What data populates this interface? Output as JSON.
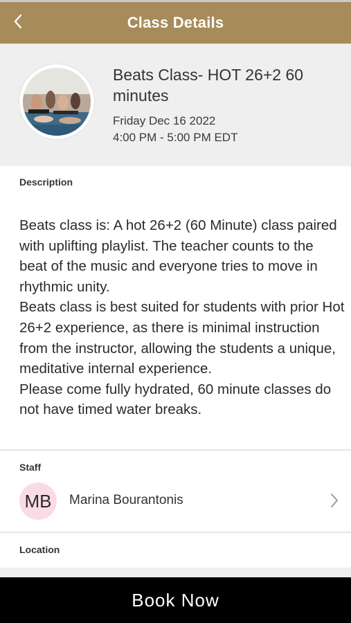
{
  "header": {
    "title": "Class Details",
    "back_icon": "chevron-left-icon",
    "background_color": "#a88b5a"
  },
  "class": {
    "name": "Beats Class- HOT 26+2 60 minutes",
    "date": "Friday Dec 16 2022",
    "time": "4:00 PM - 5:00 PM EDT"
  },
  "description": {
    "label": "Description",
    "text": "Beats class is: A hot 26+2 (60 Minute) class paired with  uplifting playlist. The teacher counts to the beat of the music and everyone tries to move in rhythmic unity.\nBeats class is best suited for students with prior Hot 26+2 experience, as there is minimal instruction from the instructor, allowing the students a unique, meditative internal experience.\nPlease come fully hydrated, 60 minute classes do not have timed water breaks."
  },
  "staff": {
    "label": "Staff",
    "initials": "MB",
    "name": "Marina Bourantonis",
    "avatar_color": "#f9dbe6",
    "chevron_icon": "chevron-right-icon"
  },
  "location": {
    "label": "Location"
  },
  "footer": {
    "book_label": "Book Now"
  }
}
